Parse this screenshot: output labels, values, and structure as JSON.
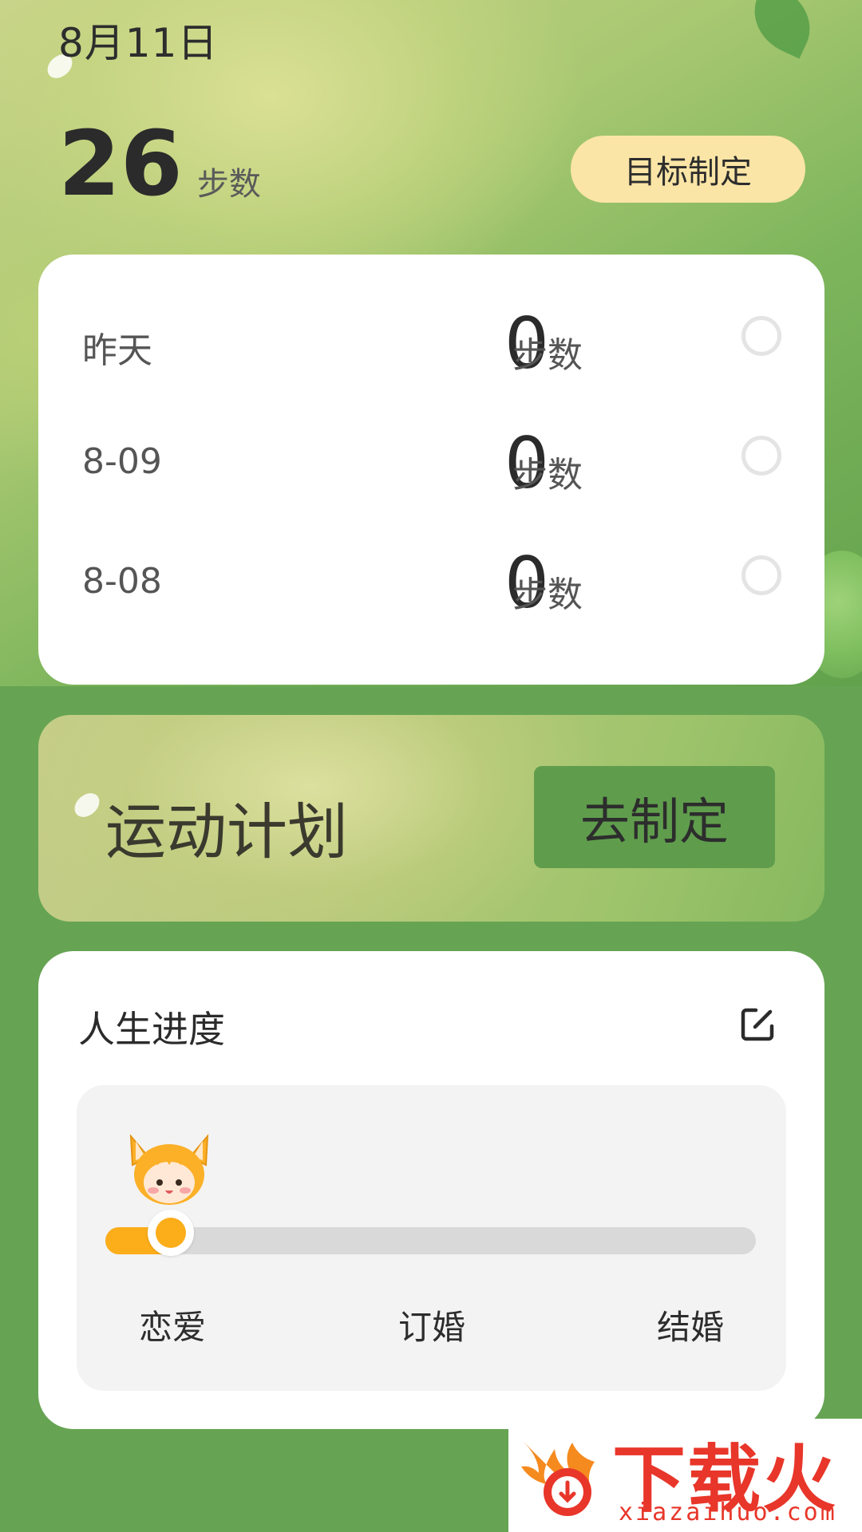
{
  "header": {
    "date": "8月11日",
    "today_steps": "26",
    "steps_unit": "步数",
    "goal_button": "目标制定"
  },
  "history": {
    "rows": [
      {
        "label": "昨天",
        "value": "0",
        "unit": "步数",
        "checked": false
      },
      {
        "label": "8-09",
        "value": "0",
        "unit": "步数",
        "checked": false
      },
      {
        "label": "8-08",
        "value": "0",
        "unit": "步数",
        "checked": false
      }
    ]
  },
  "plan": {
    "title": "运动计划",
    "button": "去制定"
  },
  "life_progress": {
    "title": "人生进度",
    "progress_fraction": 0.1,
    "stages": [
      "恋爱",
      "订婚",
      "结婚"
    ]
  },
  "watermark": {
    "text": "下载火",
    "url": "xiazaihuo.com"
  },
  "colors": {
    "background_green": "#66a453",
    "goal_button_bg": "#fbe5a6",
    "plan_button_bg": "#5f9d4c",
    "progress_accent": "#fbad1a",
    "watermark_red": "#e8362a"
  }
}
